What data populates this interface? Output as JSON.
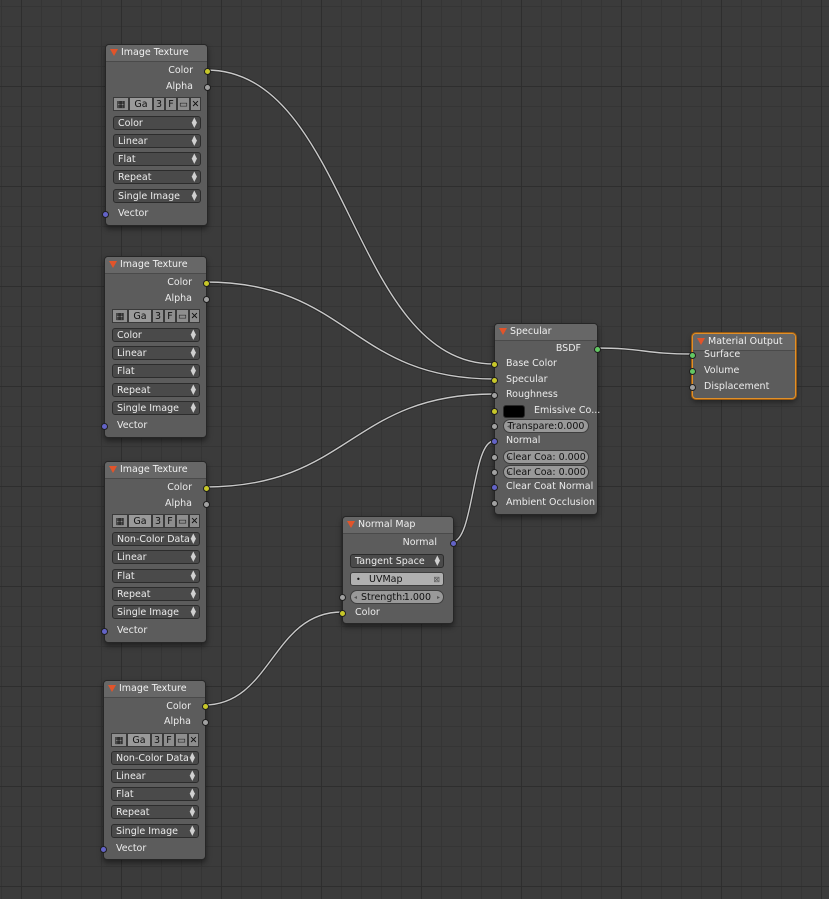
{
  "nodes": {
    "tex1": {
      "title": "Image Texture",
      "out_color": "Color",
      "out_alpha": "Alpha",
      "img": {
        "name": "Ga",
        "users": "3",
        "fake": "F"
      },
      "color_space": "Color",
      "interpolation": "Linear",
      "projection": "Flat",
      "extension": "Repeat",
      "source": "Single Image",
      "in_vector": "Vector"
    },
    "tex2": {
      "title": "Image Texture",
      "out_color": "Color",
      "out_alpha": "Alpha",
      "img": {
        "name": "Ga",
        "users": "3",
        "fake": "F"
      },
      "color_space": "Color",
      "interpolation": "Linear",
      "projection": "Flat",
      "extension": "Repeat",
      "source": "Single Image",
      "in_vector": "Vector"
    },
    "tex3": {
      "title": "Image Texture",
      "out_color": "Color",
      "out_alpha": "Alpha",
      "img": {
        "name": "Ga",
        "users": "3",
        "fake": "F"
      },
      "color_space": "Non-Color Data",
      "interpolation": "Linear",
      "projection": "Flat",
      "extension": "Repeat",
      "source": "Single Image",
      "in_vector": "Vector"
    },
    "tex4": {
      "title": "Image Texture",
      "out_color": "Color",
      "out_alpha": "Alpha",
      "img": {
        "name": "Ga",
        "users": "3",
        "fake": "F"
      },
      "color_space": "Non-Color Data",
      "interpolation": "Linear",
      "projection": "Flat",
      "extension": "Repeat",
      "source": "Single Image",
      "in_vector": "Vector"
    },
    "normal_map": {
      "title": "Normal Map",
      "out_normal": "Normal",
      "space": "Tangent Space",
      "uvmap": "UVMap",
      "strength_label": "Strength:",
      "strength_value": "1.000",
      "in_color": "Color"
    },
    "specular": {
      "title": "Specular",
      "out_bsdf": "BSDF",
      "base_color": "Base Color",
      "specular": "Specular",
      "roughness": "Roughness",
      "emissive": "Emissive Co...",
      "transparency": "Transpare:0.000",
      "normal": "Normal",
      "clear_coat": "Clear Coa: 0.000",
      "clear_coat_roughness": "Clear Coa: 0.000",
      "clear_coat_normal": "Clear Coat Normal",
      "ambient_occlusion": "Ambient Occlusion"
    },
    "output": {
      "title": "Material Output",
      "surface": "Surface",
      "volume": "Volume",
      "displacement": "Displacement"
    }
  },
  "colors": {
    "socket_color": "#c7c729",
    "socket_value": "#a1a1a1",
    "socket_vector": "#6363c7",
    "socket_shader": "#63c763",
    "header_triangle": "#e2542a",
    "active_outline": "#e0902a",
    "link": "#c8c8c8"
  },
  "icons": {
    "collapse": "node-collapse-triangle-icon",
    "image": "image-browse-icon",
    "open": "folder-open-icon",
    "unlink": "unlink-x-icon"
  }
}
